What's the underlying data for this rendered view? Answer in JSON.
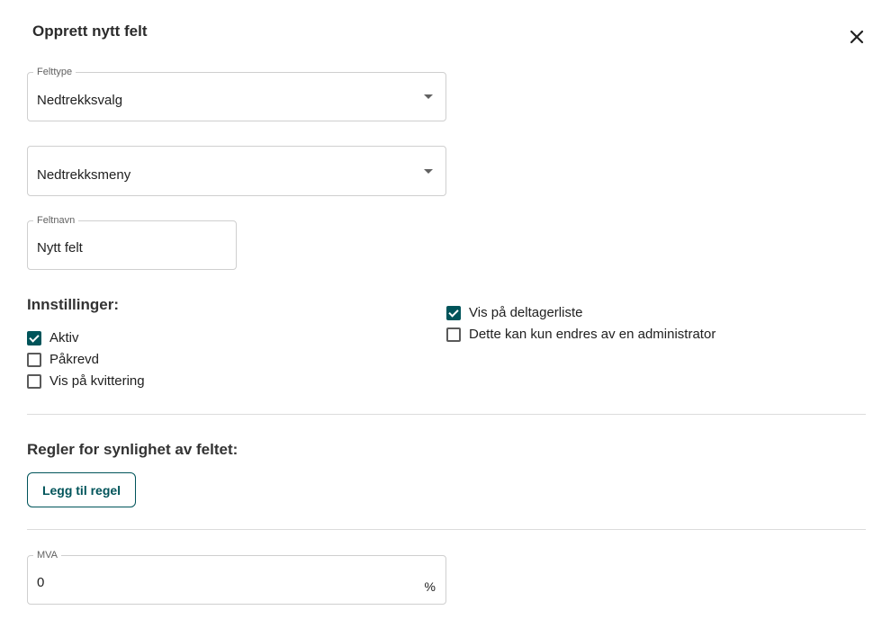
{
  "dialog": {
    "title": "Opprett nytt felt",
    "close_icon": "close-icon"
  },
  "field_type": {
    "label": "Felttype",
    "value": "Nedtrekksvalg"
  },
  "dropdown_style": {
    "label": "",
    "value": "Nedtrekksmeny"
  },
  "field_name": {
    "label": "Feltnavn",
    "value": "Nytt felt"
  },
  "settings": {
    "heading": "Innstillinger:",
    "left": [
      {
        "label": "Aktiv",
        "checked": true
      },
      {
        "label": "Påkrevd",
        "checked": false
      },
      {
        "label": "Vis på kvittering",
        "checked": false
      }
    ],
    "right": [
      {
        "label": "Vis på deltagerliste",
        "checked": true
      },
      {
        "label": "Dette kan kun endres av en administrator",
        "checked": false
      }
    ]
  },
  "visibility_rules": {
    "heading": "Regler for synlighet av feltet:",
    "add_rule_label": "Legg til regel"
  },
  "vat": {
    "label": "MVA",
    "value": "0",
    "suffix": "%"
  },
  "colors": {
    "accent": "#00545a",
    "border": "#cfcfcf",
    "divider": "#dcdcdc"
  }
}
